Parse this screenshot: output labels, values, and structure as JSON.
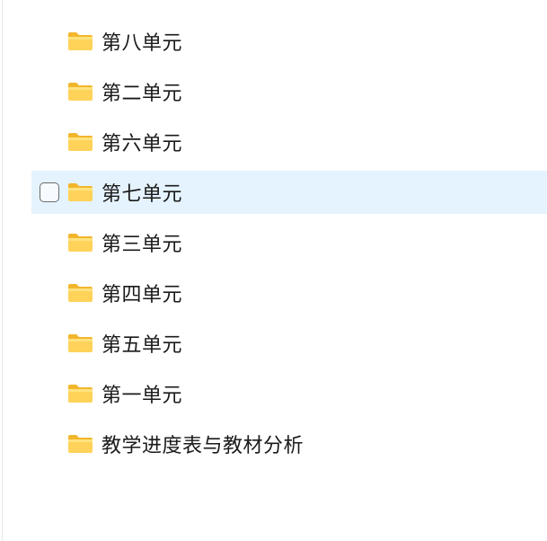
{
  "file_list": {
    "items": [
      {
        "label": "第八单元",
        "icon": "folder-icon",
        "selected": false
      },
      {
        "label": "第二单元",
        "icon": "folder-icon",
        "selected": false
      },
      {
        "label": "第六单元",
        "icon": "folder-icon",
        "selected": false
      },
      {
        "label": "第七单元",
        "icon": "folder-icon",
        "selected": true
      },
      {
        "label": "第三单元",
        "icon": "folder-icon",
        "selected": false
      },
      {
        "label": "第四单元",
        "icon": "folder-icon",
        "selected": false
      },
      {
        "label": "第五单元",
        "icon": "folder-icon",
        "selected": false
      },
      {
        "label": "第一单元",
        "icon": "folder-icon",
        "selected": false
      },
      {
        "label": "教学进度表与教材分析",
        "icon": "folder-icon",
        "selected": false
      }
    ]
  },
  "colors": {
    "selection_bg": "#e5f3fe",
    "folder_body": "#ffd35a",
    "folder_tab": "#f2b62c"
  }
}
